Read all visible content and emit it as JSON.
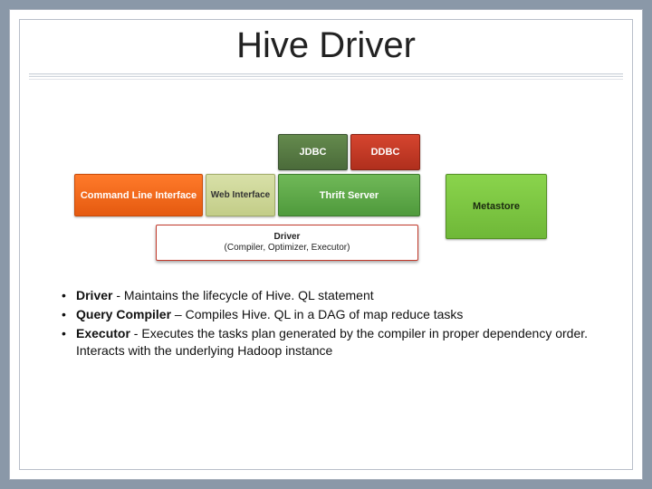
{
  "title": "Hive Driver",
  "diagram": {
    "cli": "Command Line Interface",
    "web": "Web Interface",
    "thrift": "Thrift Server",
    "jdbc": "JDBC",
    "ddbc": "DDBC",
    "metastore": "Metastore",
    "driver_title": "Driver",
    "driver_sub": "(Compiler, Optimizer, Executor)"
  },
  "bullets": [
    {
      "term": "Driver",
      "sep": " - ",
      "text": "Maintains the lifecycle of Hive. QL statement"
    },
    {
      "term": "Query Compiler",
      "sep": " – ",
      "text": "Compiles Hive. QL in a DAG of map reduce tasks"
    },
    {
      "term": "Executor",
      "sep": " -  ",
      "text": "Executes the tasks plan generated by the compiler in proper dependency order.  Interacts with the underlying Hadoop instance"
    }
  ]
}
